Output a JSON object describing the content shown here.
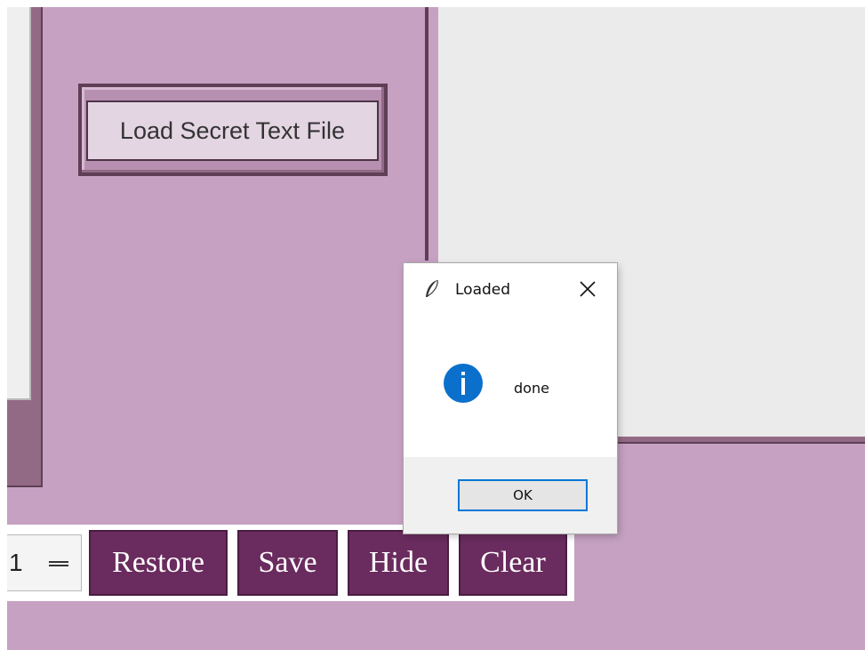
{
  "main": {
    "load_button_label": "Load Secret Text File"
  },
  "toolbar": {
    "spin_value": "1",
    "restore_label": "Restore",
    "save_label": "Save",
    "hide_label": "Hide",
    "clear_label": "Clear"
  },
  "dialog": {
    "title": "Loaded",
    "message": "done",
    "ok_label": "OK",
    "icons": [
      "feather-icon",
      "close-icon",
      "info-icon"
    ]
  },
  "colors": {
    "app_background": "#c6a1c2",
    "button_background": "#6a2b5e",
    "accent": "#0078d7"
  }
}
